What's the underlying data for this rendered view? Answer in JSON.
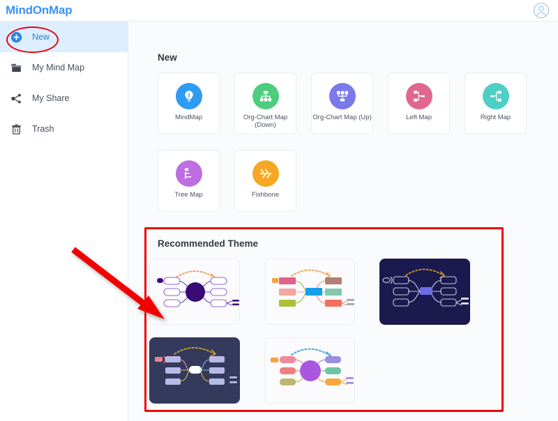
{
  "app": {
    "logo_text": "MindOnMap",
    "avatar_icon": "user-circle-icon"
  },
  "sidebar": {
    "items": [
      {
        "label": "New",
        "icon": "plus-circle-icon",
        "active": true
      },
      {
        "label": "My Mind Map",
        "icon": "folder-icon",
        "active": false
      },
      {
        "label": "My Share",
        "icon": "share-nodes-icon",
        "active": false
      },
      {
        "label": "Trash",
        "icon": "trash-icon",
        "active": false
      }
    ]
  },
  "main": {
    "new_section": {
      "title": "New",
      "templates": [
        {
          "label": "MindMap",
          "icon": "lightbulb-icon",
          "color": "#2f9cf4"
        },
        {
          "label": "Org-Chart Map (Down)",
          "icon": "org-chart-down-icon",
          "color": "#4dcd7d"
        },
        {
          "label": "Org-Chart Map (Up)",
          "icon": "org-chart-up-icon",
          "color": "#7b78ea"
        },
        {
          "label": "Left Map",
          "icon": "left-map-icon",
          "color": "#e2678e"
        },
        {
          "label": "Right Map",
          "icon": "right-map-icon",
          "color": "#4ecfc5"
        },
        {
          "label": "Tree Map",
          "icon": "tree-map-icon",
          "color": "#bd6ee0"
        },
        {
          "label": "Fishbone",
          "icon": "fishbone-icon",
          "color": "#f6a723"
        }
      ]
    },
    "theme_section": {
      "title": "Recommended Theme",
      "themes": [
        {
          "name": "violet-light-theme",
          "background": "#fbfafd",
          "accent": "#3a0b77"
        },
        {
          "name": "colorful-light-theme",
          "background": "#fbfafd",
          "accent": "#12a0e8"
        },
        {
          "name": "navy-dark-theme",
          "background": "#1b1a4e",
          "accent": "#6f6ce8"
        },
        {
          "name": "slate-dark-theme",
          "background": "#343a5c",
          "accent": "#ffffff"
        },
        {
          "name": "purple-light-theme",
          "background": "#fbfafd",
          "accent": "#a957e0"
        }
      ]
    }
  },
  "annotations": {
    "highlight_color": "#f00000",
    "ellipse_target": "New",
    "box_target": "Recommended Theme",
    "arrow_target": "Recommended Theme"
  }
}
